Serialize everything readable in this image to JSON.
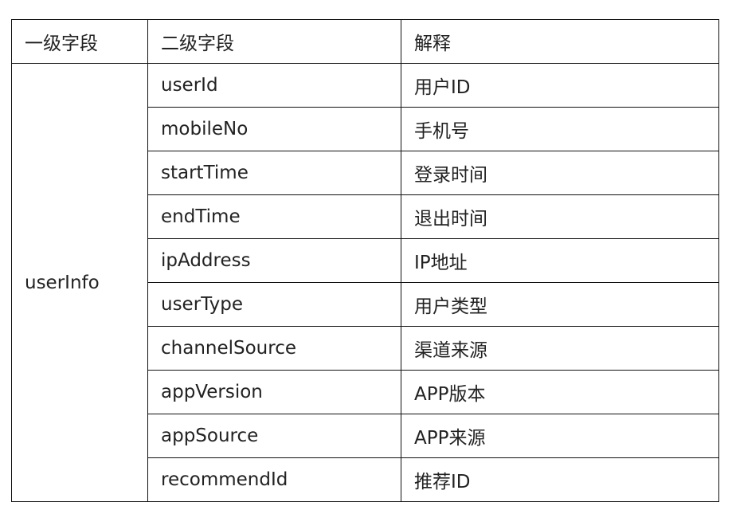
{
  "table": {
    "headers": [
      "一级字段",
      "二级字段",
      "解释"
    ],
    "group": "userInfo",
    "rows": [
      {
        "field": "userId",
        "desc": "用户ID"
      },
      {
        "field": "mobileNo",
        "desc": "手机号"
      },
      {
        "field": "startTime",
        "desc": "登录时间"
      },
      {
        "field": "endTime",
        "desc": "退出时间"
      },
      {
        "field": "ipAddress",
        "desc": "IP地址"
      },
      {
        "field": "userType",
        "desc": "用户类型"
      },
      {
        "field": "channelSource",
        "desc": "渠道来源"
      },
      {
        "field": "appVersion",
        "desc": "APP版本"
      },
      {
        "field": "appSource",
        "desc": "APP来源"
      },
      {
        "field": "recommendId",
        "desc": "推荐ID"
      }
    ]
  },
  "colors": {
    "text": "#222222",
    "border": "#111111",
    "background": "#ffffff"
  }
}
